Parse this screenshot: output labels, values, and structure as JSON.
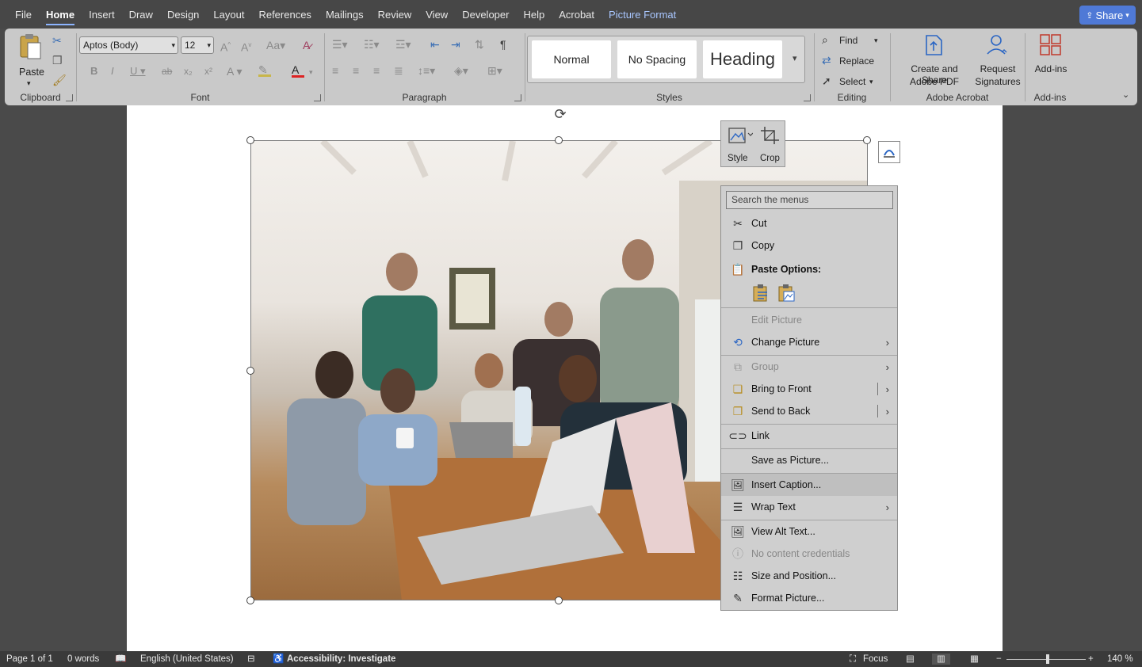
{
  "menubar": {
    "tabs": [
      "File",
      "Home",
      "Insert",
      "Draw",
      "Design",
      "Layout",
      "References",
      "Mailings",
      "Review",
      "View",
      "Developer",
      "Help",
      "Acrobat",
      "Picture Format"
    ],
    "share_label": "Share"
  },
  "ribbon": {
    "clipboard": {
      "label": "Clipboard",
      "paste_label": "Paste"
    },
    "font": {
      "label": "Font",
      "font_name": "Aptos (Body)",
      "font_size": "12"
    },
    "paragraph": {
      "label": "Paragraph"
    },
    "styles": {
      "label": "Styles",
      "items": [
        "Normal",
        "No Spacing",
        "Heading"
      ]
    },
    "editing": {
      "label": "Editing",
      "find": "Find",
      "replace": "Replace",
      "select": "Select"
    },
    "acrobat": {
      "label": "Adobe Acrobat",
      "create_line1": "Create and Share",
      "create_line2": "Adobe PDF",
      "request_line1": "Request",
      "request_line2": "Signatures"
    },
    "addins": {
      "label": "Add-ins",
      "button": "Add-ins"
    }
  },
  "minibar": {
    "style": "Style",
    "crop": "Crop"
  },
  "context_menu": {
    "search_placeholder": "Search the menus",
    "cut": "Cut",
    "copy": "Copy",
    "paste_options": "Paste Options:",
    "edit_picture": "Edit Picture",
    "change_picture": "Change Picture",
    "group": "Group",
    "bring_to_front": "Bring to Front",
    "send_to_back": "Send to Back",
    "link": "Link",
    "save_as_picture": "Save as Picture...",
    "insert_caption": "Insert Caption...",
    "wrap_text": "Wrap Text",
    "view_alt_text": "View Alt Text...",
    "no_content_credentials": "No content credentials",
    "size_and_position": "Size and Position...",
    "format_picture": "Format Picture..."
  },
  "status": {
    "page": "Page 1 of 1",
    "words": "0 words",
    "language": "English (United States)",
    "accessibility": "Accessibility: Investigate",
    "focus": "Focus",
    "zoom": "140 %"
  }
}
